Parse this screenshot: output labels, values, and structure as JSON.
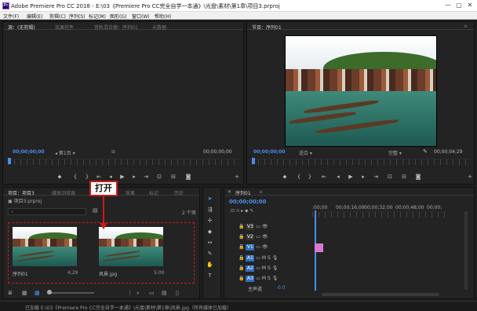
{
  "window": {
    "title": "Adobe Premiere Pro CC 2018 - E:\\03《Premiere Pro CC完全自学一本通》\\光盘\\素材\\第1章\\项目3.prproj",
    "app_icon": "Pr",
    "min": "—",
    "max": "▢",
    "close": "✕"
  },
  "menu": [
    "文件(F)",
    "编辑(E)",
    "剪辑(C)",
    "序列(S)",
    "标记(M)",
    "图形(G)",
    "窗口(W)",
    "帮助(H)"
  ],
  "source": {
    "tabs": [
      "源：(无剪辑)",
      "效果控件",
      "音轨混合器：序列01",
      "元数据"
    ],
    "timecode_left": "00;00;00;00",
    "page_label": "第1页",
    "timecode_right": "00;00;00;00"
  },
  "program": {
    "tab": "节目：序列01",
    "timecode_left": "00;00;00;00",
    "fit": "适合",
    "quality": "完整",
    "timecode_right": "00;00;04;29"
  },
  "project": {
    "tabs": [
      "项目：项目3",
      "媒体浏览器",
      "库",
      "信息",
      "效果",
      "标记",
      "历史"
    ],
    "file": "项目3.prproj",
    "count": "2 个项",
    "items": [
      {
        "name": "序列01",
        "duration": "4;29"
      },
      {
        "name": "风景.jpg",
        "duration": "5:00"
      }
    ]
  },
  "callout": {
    "text": "打开"
  },
  "timeline": {
    "tab": "序列01",
    "timecode": "00;00;00;00",
    "ruler": [
      ":00;00",
      "00;00;16;00",
      "00;00;32;00",
      "00;00;48;00",
      "00;00;"
    ],
    "video_tracks": [
      "V3",
      "V2",
      "V1"
    ],
    "audio_tracks": [
      "A1",
      "A2",
      "A3"
    ],
    "master": "主声道",
    "master_val": "0.0",
    "track_ms": "M",
    "track_s": "S"
  },
  "status": {
    "text": "已加载 E:\\03《Premiere Pro CC完全自学一本通》\\光盘\\素材\\第1章\\风景.jpg（所有媒体已加载）"
  },
  "colors": {
    "accent": "#4a8fe8",
    "clip": "#d47ad4",
    "callout": "#d01818"
  }
}
